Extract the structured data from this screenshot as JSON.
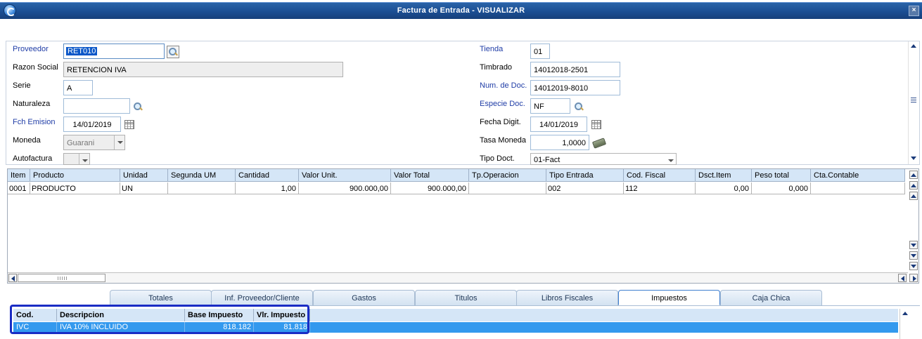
{
  "window": {
    "title": "Factura de Entrada - VISUALIZAR",
    "close_label": "×"
  },
  "form": {
    "left": [
      {
        "label": "Proveedor",
        "value": "RET010"
      },
      {
        "label": "Razon Social",
        "value": "RETENCION IVA"
      },
      {
        "label": "Serie",
        "value": "A"
      },
      {
        "label": "Naturaleza",
        "value": ""
      },
      {
        "label": "Fch Emision",
        "value": "14/01/2019"
      },
      {
        "label": "Moneda",
        "value": "Guarani"
      },
      {
        "label": "Autofactura",
        "value": ""
      }
    ],
    "right": [
      {
        "label": "Tienda",
        "value": "01"
      },
      {
        "label": "Timbrado",
        "value": "14012018-2501"
      },
      {
        "label": "Num. de Doc.",
        "value": "14012019-8010"
      },
      {
        "label": "Especie Doc.",
        "value": "NF"
      },
      {
        "label": "Fecha Digit.",
        "value": "14/01/2019"
      },
      {
        "label": "Tasa Moneda",
        "value": "1,0000"
      },
      {
        "label": "Tipo Doct.",
        "value": "01-Fact"
      }
    ]
  },
  "items_grid": {
    "columns": [
      "Item",
      "Producto",
      "Unidad",
      "Segunda UM",
      "Cantidad",
      "Valor Unit.",
      "Valor Total",
      "Tp.Operacion",
      "Tipo Entrada",
      "Cod. Fiscal",
      "Dsct.Item",
      "Peso total",
      "Cta.Contable"
    ],
    "rows": [
      [
        "0001",
        "PRODUCTO",
        "UN",
        "",
        "1,00",
        "900.000,00",
        "900.000,00",
        "",
        "002",
        "112",
        "0,00",
        "0,000",
        ""
      ]
    ]
  },
  "tabs": [
    "Totales",
    "Inf. Proveedor/Cliente",
    "Gastos",
    "Titulos",
    "Libros Fiscales",
    "Impuestos",
    "Caja Chica"
  ],
  "active_tab": "Impuestos",
  "tax_grid": {
    "columns": [
      "Cod.",
      "Descripcion",
      "Base Impuesto",
      "Vlr. Impuesto"
    ],
    "rows": [
      [
        "IVC",
        "IVA 10% INCLUIDO",
        "818.182",
        "81.818"
      ]
    ]
  },
  "colors": {
    "titlebar": "#1b4e93",
    "selected_row": "#3399ee",
    "highlight_box": "#1a2cc4",
    "required_label": "#1f3ca6"
  }
}
